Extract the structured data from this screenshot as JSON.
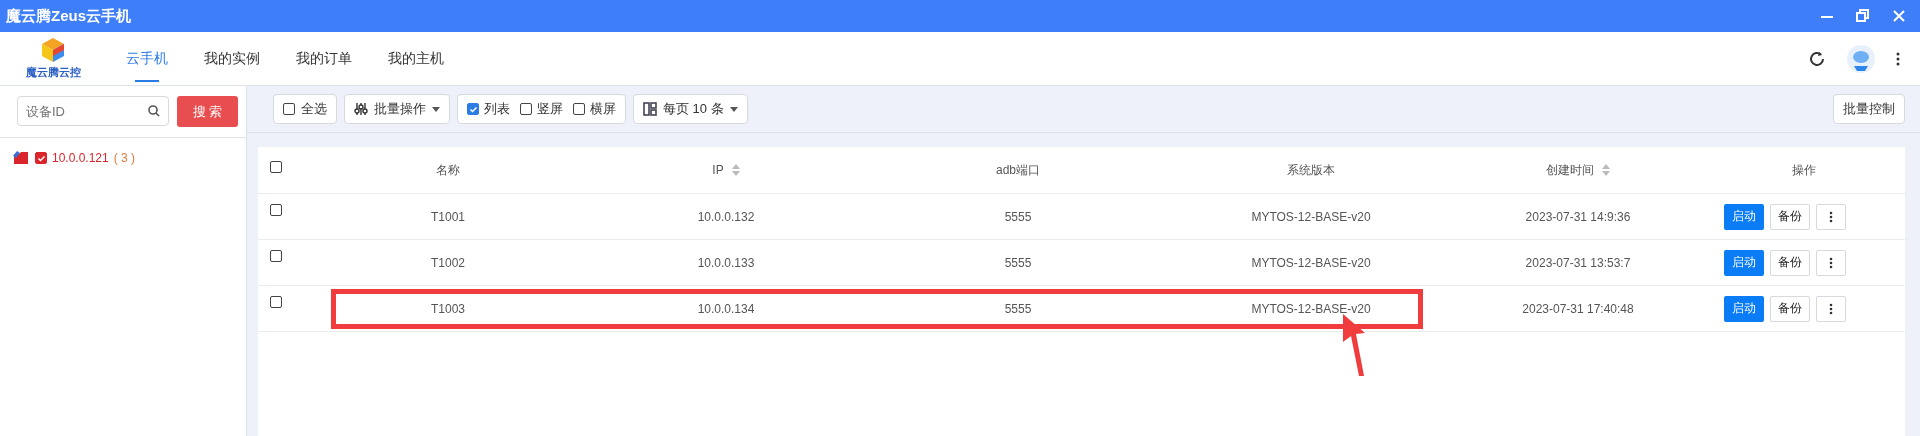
{
  "window": {
    "title": "魔云腾Zeus云手机"
  },
  "logo": {
    "text": "魔云腾云控"
  },
  "nav": [
    {
      "label": "云手机",
      "selected": true
    },
    {
      "label": "我的实例",
      "selected": false
    },
    {
      "label": "我的订单",
      "selected": false
    },
    {
      "label": "我的主机",
      "selected": false
    }
  ],
  "search": {
    "placeholder": "设备ID",
    "button": "搜 索"
  },
  "tree": [
    {
      "label": "10.0.0.121",
      "count": "( 3 )",
      "checked": true
    }
  ],
  "toolbar": {
    "select_all": {
      "label": "全选",
      "checked": false
    },
    "batch": "批量操作",
    "views": [
      {
        "label": "列表",
        "checked": true
      },
      {
        "label": "竖屏",
        "checked": false
      },
      {
        "label": "横屏",
        "checked": false
      }
    ],
    "per_page": "每页 10 条",
    "batch_control": "批量控制"
  },
  "table": {
    "columns": [
      {
        "label": "名称",
        "sortable": false
      },
      {
        "label": "IP",
        "sortable": true
      },
      {
        "label": "adb端口",
        "sortable": false
      },
      {
        "label": "系统版本",
        "sortable": false
      },
      {
        "label": "创建时间",
        "sortable": true
      },
      {
        "label": "操作",
        "sortable": false
      }
    ],
    "header_checked": false,
    "rows": [
      {
        "checked": false,
        "cells": [
          "T1001",
          "10.0.0.132",
          "5555",
          "MYTOS-12-BASE-v20",
          "2023-07-31 14:9:36"
        ],
        "start": "启动",
        "backup": "备份",
        "highlighted": false
      },
      {
        "checked": false,
        "cells": [
          "T1002",
          "10.0.0.133",
          "5555",
          "MYTOS-12-BASE-v20",
          "2023-07-31 13:53:7"
        ],
        "start": "启动",
        "backup": "备份",
        "highlighted": false
      },
      {
        "checked": false,
        "cells": [
          "T1003",
          "10.0.0.134",
          "5555",
          "MYTOS-12-BASE-v20",
          "2023-07-31 17:40:48"
        ],
        "start": "启动",
        "backup": "备份",
        "highlighted": true
      }
    ]
  }
}
